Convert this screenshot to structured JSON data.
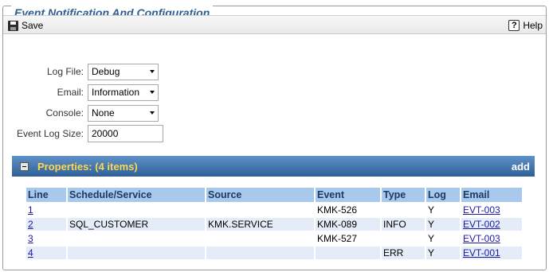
{
  "window": {
    "title": "Event Notification And Configuration"
  },
  "toolbar": {
    "save_label": "Save",
    "help_label": "Help"
  },
  "form": {
    "log_file": {
      "label": "Log File:",
      "value": "Debug"
    },
    "email": {
      "label": "Email:",
      "value": "Information"
    },
    "console": {
      "label": "Console:",
      "value": "None"
    },
    "event_log_size": {
      "label": "Event Log Size:",
      "value": "20000"
    }
  },
  "properties": {
    "title": "Properties: (4 items)",
    "add_label": "add",
    "columns": [
      "Line",
      "Schedule/Service",
      "Source",
      "Event",
      "Type",
      "Log",
      "Email"
    ],
    "rows": [
      {
        "line": "1",
        "schedule": "",
        "source": "",
        "event": "KMK-526",
        "type": "",
        "log": "Y",
        "email": "EVT-003"
      },
      {
        "line": "2",
        "schedule": "SQL_CUSTOMER",
        "source": "KMK.SERVICE",
        "event": "KMK-089",
        "type": "INFO",
        "log": "Y",
        "email": "EVT-002"
      },
      {
        "line": "3",
        "schedule": "",
        "source": "",
        "event": "KMK-527",
        "type": "",
        "log": "Y",
        "email": "EVT-003"
      },
      {
        "line": "4",
        "schedule": "",
        "source": "",
        "event": "",
        "type": "ERR",
        "log": "Y",
        "email": "EVT-001"
      }
    ]
  },
  "colors": {
    "title": "#2e5f92",
    "panel_bar": "#3a6ba3",
    "panel_title": "#ffd84d",
    "header_bg": "#a8c8ec",
    "alt_row": "#e3ecf7"
  }
}
